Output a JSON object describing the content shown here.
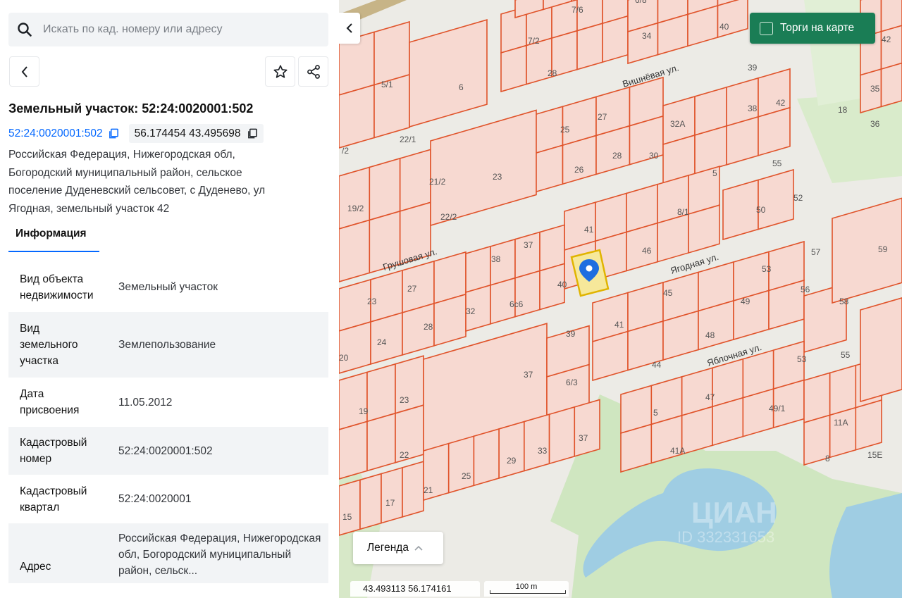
{
  "search": {
    "placeholder": "Искать по кад. номеру или адресу"
  },
  "object": {
    "title": "Земельный участок: 52:24:0020001:502",
    "cad_number_link": "52:24:0020001:502",
    "coords": "56.174454 43.495698",
    "address_lines": [
      "Российская Федерация, Нижегородская обл,",
      "Богородский муниципальный район, сельское",
      "поселение Дуденевский сельсовет, с Дуденево, ул",
      "Ягодная, земельный участок 42"
    ]
  },
  "tabs": {
    "info": "Информация"
  },
  "info_rows": [
    {
      "key": "Вид объекта недвижимости",
      "value": "Земельный участок"
    },
    {
      "key": "Вид земельного участка",
      "value": "Землепользование"
    },
    {
      "key": "Дата присвоения",
      "value": "11.05.2012"
    },
    {
      "key": "Кадастровый номер",
      "value": "52:24:0020001:502"
    },
    {
      "key": "Кадастровый квартал",
      "value": "52:24:0020001"
    },
    {
      "key": "Адрес",
      "value": "Российская Федерация, Нижегородская обл, Богородский муниципальный район, сельск..."
    }
  ],
  "map": {
    "torgi_label": "Торги на карте",
    "legend_label": "Легенда",
    "cursor_coords": "43.493113  56.174161",
    "scale_label": "100 m",
    "watermark_brand": "ЦИАН",
    "watermark_id": "ID 332331653",
    "streets": {
      "vishnevaya": "Вишнёвая ул.",
      "grushovaya": "Грушовая ул.",
      "yagodnaya": "Ягодная ул.",
      "yablochnaya": "Яблочная ул."
    },
    "parcel_numbers": [
      "7/6",
      "6/8",
      "34",
      "40",
      "42",
      "7/2",
      "28",
      "39",
      "6",
      "5/1",
      "6",
      "25",
      "27",
      "32А",
      "38",
      "42",
      "18",
      "35",
      "36",
      "22/1",
      "/2",
      "23",
      "21/2",
      "26",
      "28",
      "30",
      "5",
      "55",
      "52",
      "19/2",
      "22/2",
      "8/1",
      "50",
      "59",
      "41",
      "46",
      "57",
      "37",
      "38",
      "53",
      "40",
      "56",
      "23",
      "27",
      "6с6",
      "32",
      "45",
      "49",
      "58",
      "28",
      "39",
      "41",
      "48",
      "24",
      "20",
      "37",
      "6/3",
      "44",
      "53",
      "55",
      "19",
      "23",
      "5",
      "47",
      "49/1",
      "22",
      "33",
      "37",
      "29",
      "41А",
      "11А",
      "8",
      "15Е",
      "25",
      "21",
      "17",
      "15"
    ],
    "colors": {
      "parcel_fill": "#f7d9d1",
      "parcel_stroke": "#e0532a",
      "selected_fill": "#f6e89a",
      "selected_stroke": "#e0b400",
      "pin": "#1e6ee0",
      "accent": "#1a7d55",
      "link": "#0468ff"
    }
  }
}
